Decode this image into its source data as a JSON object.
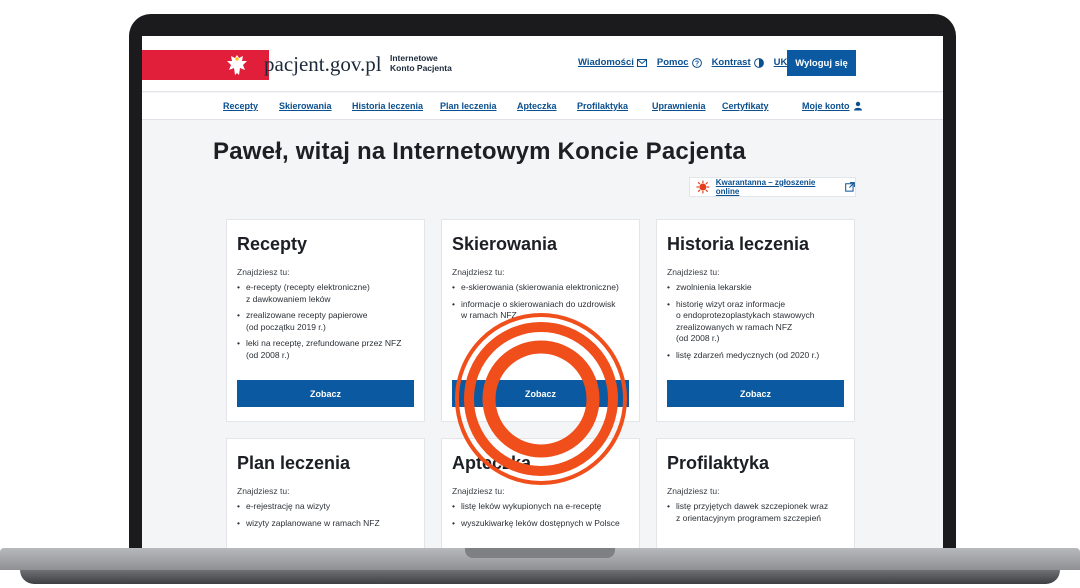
{
  "header": {
    "brand": "pacjent.gov.pl",
    "subtitle_line1": "Internetowe",
    "subtitle_line2": "Konto Pacjenta",
    "links": [
      "Wiadomości",
      "Pomoc",
      "Kontrast",
      "UK"
    ],
    "logout_label": "Wyloguj się"
  },
  "nav": {
    "items": [
      "Recepty",
      "Skierowania",
      "Historia leczenia",
      "Plan leczenia",
      "Apteczka",
      "Profilaktyka",
      "Uprawnienia",
      "Certyfikaty"
    ],
    "account_label": "Moje konto"
  },
  "main": {
    "title": "Paweł, witaj na Internetowym Koncie Pacjenta",
    "quarantine_link": "Kwarantanna – zgłoszenie online"
  },
  "cards": [
    {
      "title": "Recepty",
      "lead": "Znajdziesz tu:",
      "items": [
        [
          "e-recepty (recepty elektroniczne)",
          "z dawkowaniem leków"
        ],
        [
          "zrealizowane recepty papierowe",
          "(od początku 2019 r.)"
        ],
        [
          "leki na receptę, zrefundowane przez NFZ",
          "(od 2008 r.)"
        ]
      ],
      "button": "Zobacz"
    },
    {
      "title": "Skierowania",
      "lead": "Znajdziesz tu:",
      "items": [
        [
          "e-skierowania (skierowania elektroniczne)"
        ],
        [
          "informacje o skierowaniach do uzdrowisk",
          "w ramach NFZ"
        ]
      ],
      "button": "Zobacz"
    },
    {
      "title": "Historia leczenia",
      "lead": "Znajdziesz tu:",
      "items": [
        [
          "zwolnienia lekarskie"
        ],
        [
          "historię wizyt oraz informacje",
          "o endoprotezoplastykach stawowych",
          "zrealizowanych w ramach NFZ",
          "(od 2008 r.)"
        ],
        [
          "listę zdarzeń medycznych (od 2020 r.)"
        ]
      ],
      "button": "Zobacz"
    },
    {
      "title": "Plan leczenia",
      "lead": "Znajdziesz tu:",
      "items": [
        [
          "e-rejestrację na wizyty"
        ],
        [
          "wizyty zaplanowane w ramach NFZ"
        ]
      ]
    },
    {
      "title": "Apteczka",
      "lead": "Znajdziesz tu:",
      "items": [
        [
          "listę leków wykupionych na e-receptę"
        ],
        [
          "wyszukiwarkę leków dostępnych w Polsce"
        ]
      ]
    },
    {
      "title": "Profilaktyka",
      "lead": "Znajdziesz tu:",
      "items": [
        [
          "listę przyjętych dawek szczepionek wraz",
          "z orientacyjnym programem szczepień"
        ]
      ]
    }
  ],
  "colors": {
    "primary": "#0b5aa1",
    "link": "#0a4f8f",
    "flag_red": "#e11f3a",
    "target_orange": "#f04e1b"
  }
}
